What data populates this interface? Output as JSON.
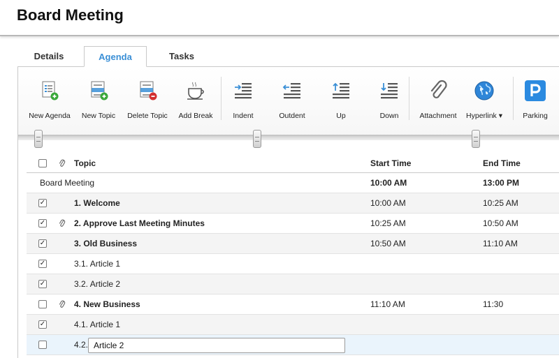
{
  "header": {
    "title": "Board Meeting"
  },
  "tabs": [
    {
      "label": "Details",
      "active": false
    },
    {
      "label": "Agenda",
      "active": true
    },
    {
      "label": "Tasks",
      "active": false
    }
  ],
  "toolbar": [
    {
      "label": "New Agenda",
      "icon": "new-agenda-icon"
    },
    {
      "label": "New Topic",
      "icon": "new-topic-icon"
    },
    {
      "label": "Delete Topic",
      "icon": "delete-topic-icon"
    },
    {
      "label": "Add Break",
      "icon": "coffee-cup-icon"
    },
    {
      "label": "Indent",
      "icon": "indent-icon"
    },
    {
      "label": "Outdent",
      "icon": "outdent-icon"
    },
    {
      "label": "Up",
      "icon": "move-up-icon"
    },
    {
      "label": "Down",
      "icon": "move-down-icon"
    },
    {
      "label": "Attachment",
      "icon": "paperclip-icon"
    },
    {
      "label": "Hyperlink ▾",
      "icon": "globe-icon"
    },
    {
      "label": "Parking",
      "icon": "parking-icon"
    }
  ],
  "colors": {
    "accent": "#3a8fd6",
    "parking": "#2b8ae0",
    "add": "#3aa83a",
    "delete": "#d33030"
  },
  "agenda": {
    "columns": {
      "topic": "Topic",
      "start": "Start Time",
      "end": "End Time"
    },
    "meeting": {
      "topic": "Board Meeting",
      "start": "10:00 AM",
      "end": "13:00 PM"
    },
    "rows": [
      {
        "checked": true,
        "attachment": false,
        "topic": "1. Welcome",
        "start": "10:00 AM",
        "end": "10:25 AM",
        "bold": true
      },
      {
        "checked": true,
        "attachment": true,
        "topic": "2. Approve Last Meeting Minutes",
        "start": "10:25 AM",
        "end": "10:50 AM",
        "bold": true
      },
      {
        "checked": true,
        "attachment": false,
        "topic": "3. Old Business",
        "start": "10:50 AM",
        "end": "11:10 AM",
        "bold": true
      },
      {
        "checked": true,
        "attachment": false,
        "topic": "3.1. Article 1",
        "start": "",
        "end": "",
        "bold": false
      },
      {
        "checked": true,
        "attachment": false,
        "topic": "3.2. Article 2",
        "start": "",
        "end": "",
        "bold": false
      },
      {
        "checked": false,
        "attachment": true,
        "topic": "4. New Business",
        "start": "11:10 AM",
        "end": "11:30",
        "bold": true
      },
      {
        "checked": true,
        "attachment": false,
        "topic": "4.1. Article 1",
        "start": "",
        "end": "",
        "bold": false
      }
    ],
    "editing_row": {
      "checked": false,
      "prefix": "4.2.",
      "value": "Article 2"
    }
  }
}
